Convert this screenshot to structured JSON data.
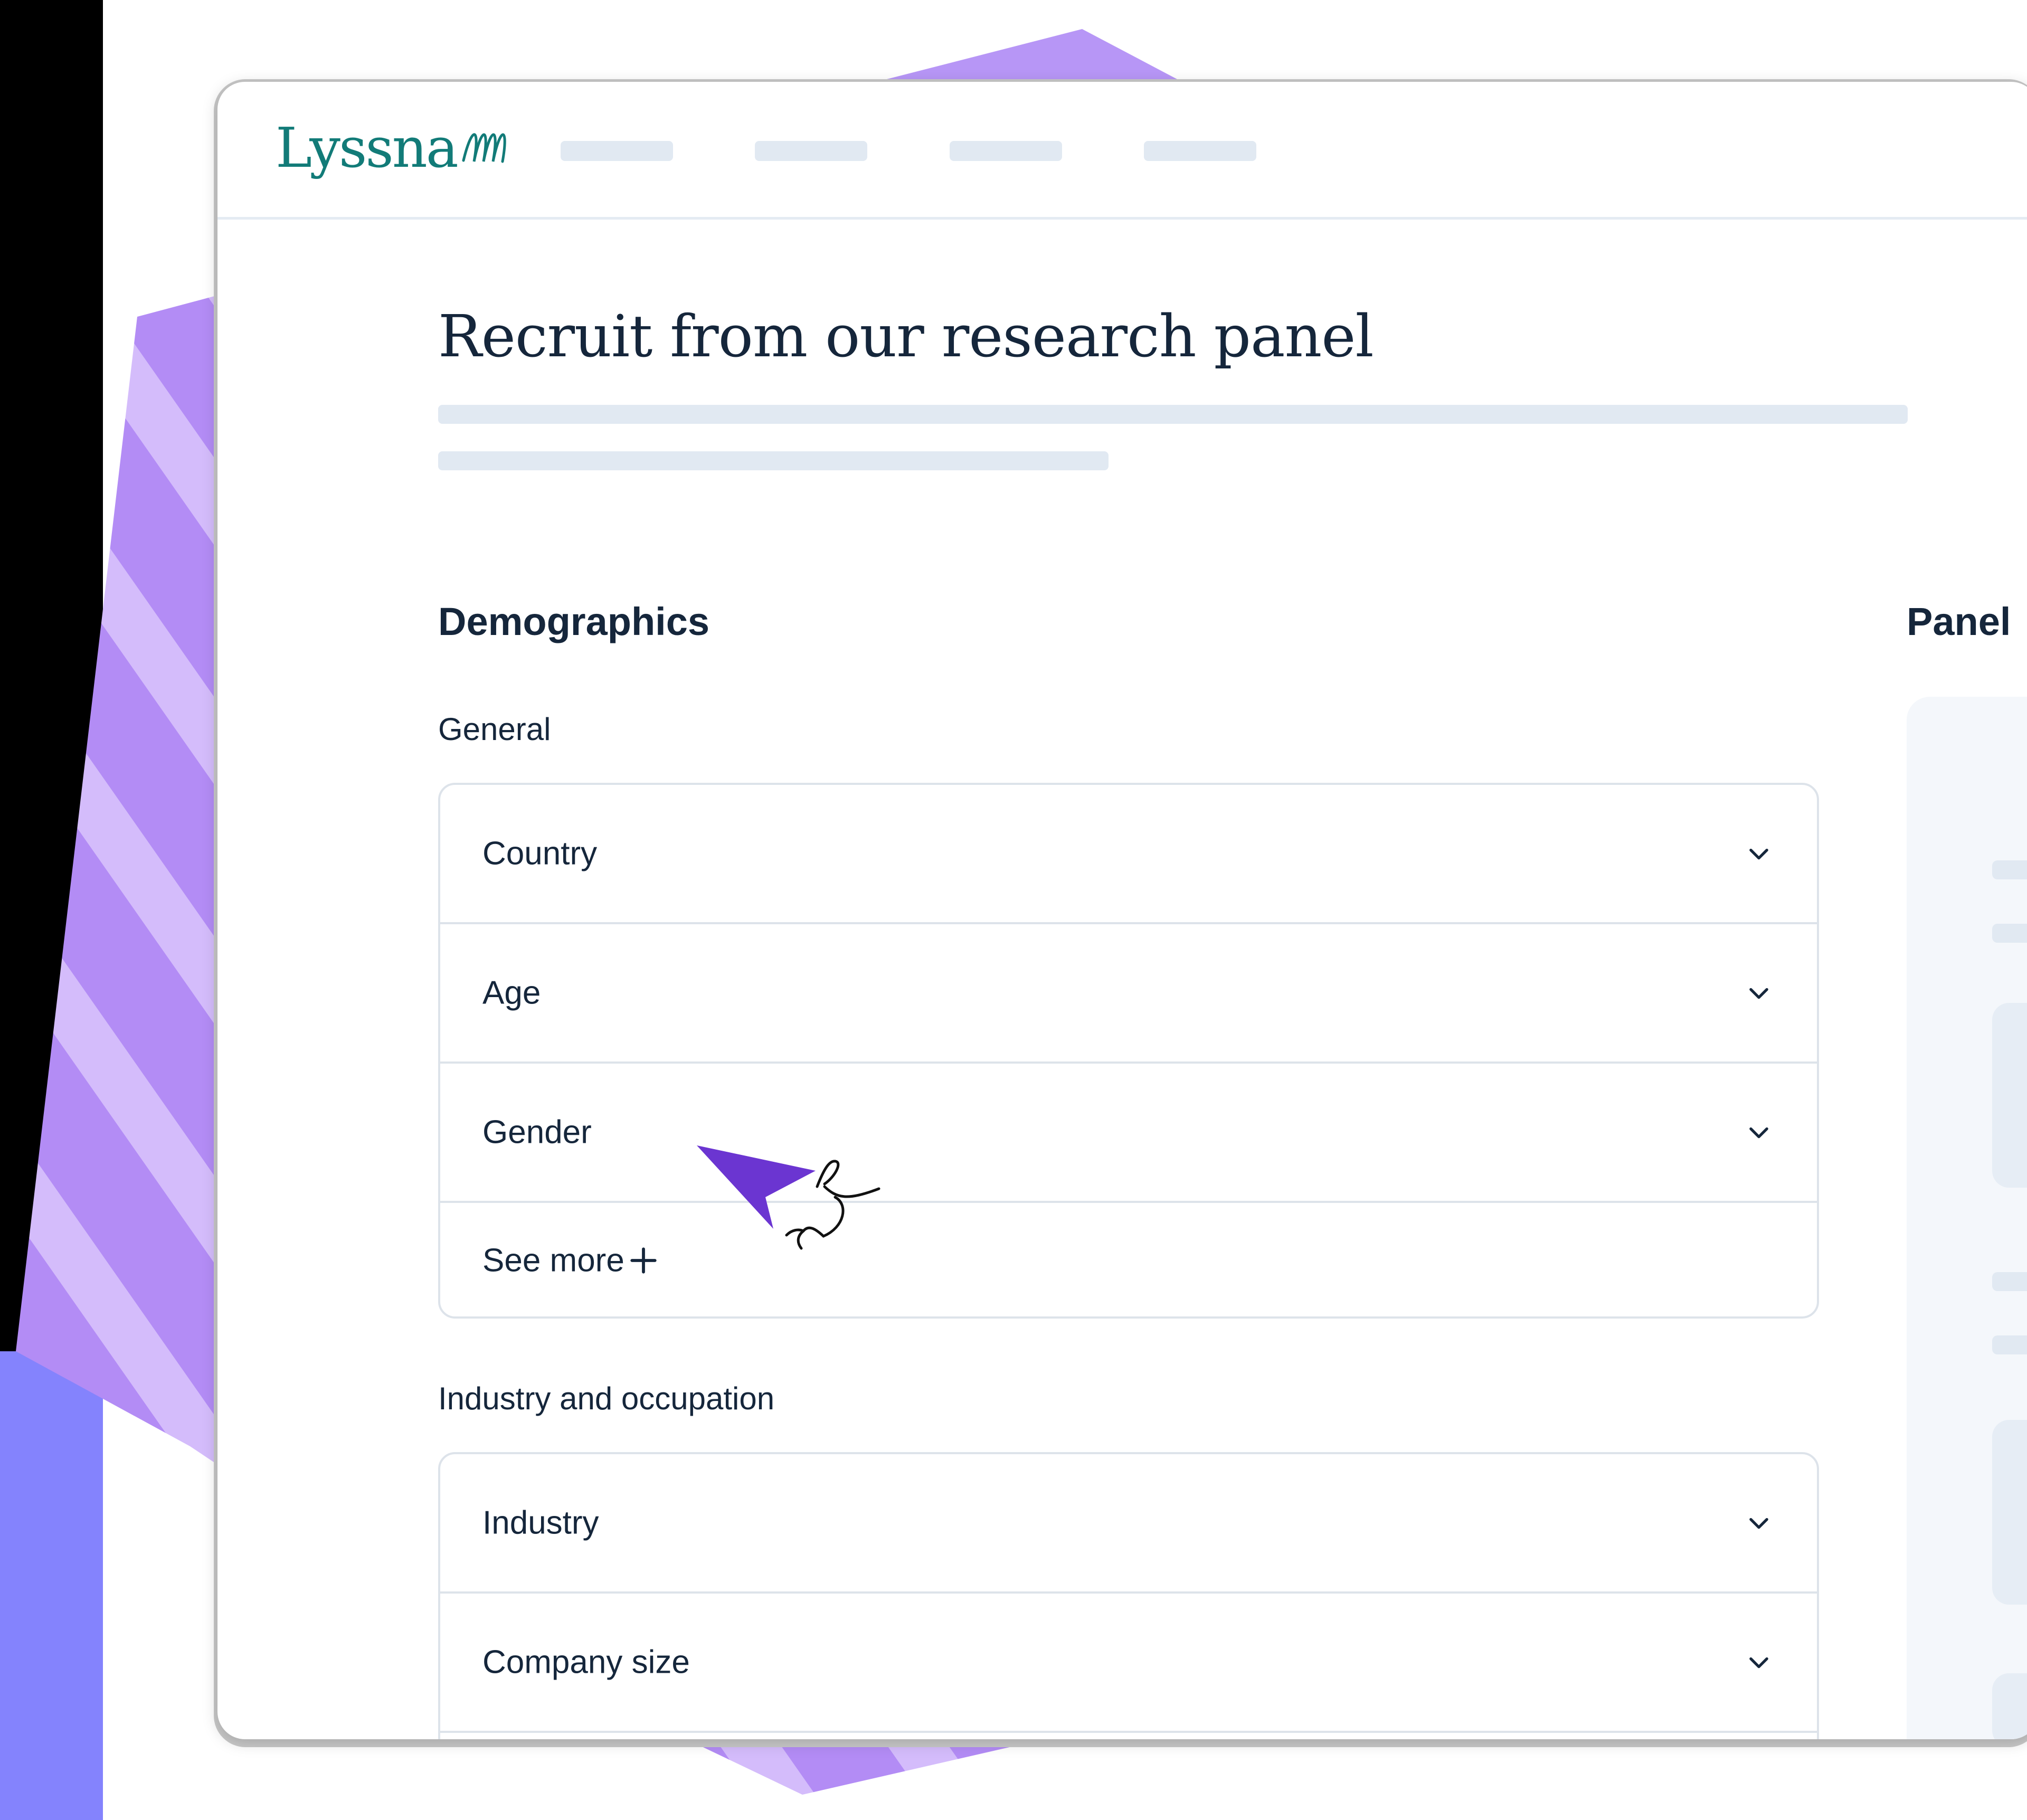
{
  "brand": {
    "name": "Lyssna",
    "color": "#127b78"
  },
  "page": {
    "title": "Recruit from our research panel"
  },
  "demographics": {
    "heading": "Demographics",
    "general": {
      "label": "General",
      "filters": [
        {
          "label": "Country"
        },
        {
          "label": "Age"
        },
        {
          "label": "Gender"
        }
      ],
      "see_more_label": "See more"
    },
    "industry_occupation": {
      "label": "Industry and occupation",
      "filters": [
        {
          "label": "Industry"
        },
        {
          "label": "Company size"
        }
      ]
    }
  },
  "panel": {
    "heading": "Panel"
  },
  "icons": {
    "row": "chevron-down-icon",
    "see_more": "plus-icon",
    "pointer": "cursor-arrow-icon"
  },
  "colors": {
    "accent": "#6b35d1",
    "background_shape": "#b796f6",
    "text": "#15263b",
    "placeholder": "#e1e9f2"
  }
}
